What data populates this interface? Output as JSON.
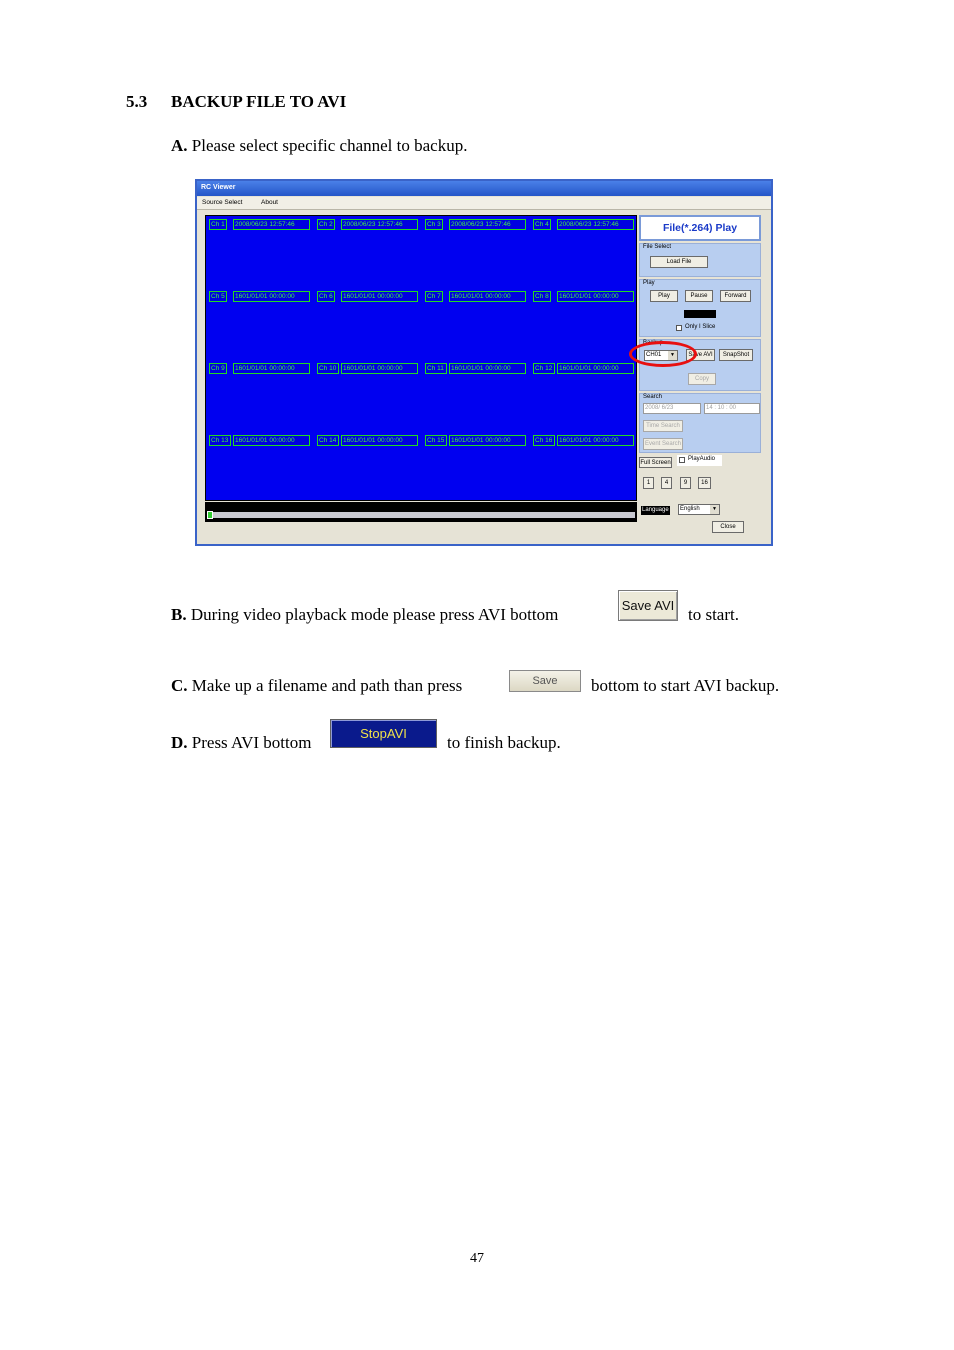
{
  "heading": {
    "number": "5.3",
    "title": "BACKUP FILE TO AVI"
  },
  "steps": {
    "a": {
      "letter": "A.",
      "text": " Please select specific channel to backup."
    },
    "b": {
      "letter": "B.",
      "text": " During video playback mode please press AVI bottom",
      "after": "to start.",
      "button_label": "Save AVI"
    },
    "c": {
      "letter": "C.",
      "text": " Make up a filename and path than press",
      "after": "bottom to start AVI backup.",
      "button_label": "Save"
    },
    "d": {
      "letter": "D.",
      "text": " Press AVI bottom",
      "after": "to finish backup.",
      "button_label": "StopAVI"
    }
  },
  "page_number": "47",
  "screenshot": {
    "window_title": "RC Viewer",
    "menu": [
      "Source Select",
      "About"
    ],
    "channels": [
      {
        "ch": "Ch 1",
        "time": "2008/06/23 12:57:46"
      },
      {
        "ch": "Ch 2",
        "time": "2008/06/23 12:57:46"
      },
      {
        "ch": "Ch 3",
        "time": "2008/06/23 12:57:46"
      },
      {
        "ch": "Ch 4",
        "time": "2008/06/23 12:57:46"
      },
      {
        "ch": "Ch 5",
        "time": "1601/01/01 00:00:00"
      },
      {
        "ch": "Ch 6",
        "time": "1601/01/01 00:00:00"
      },
      {
        "ch": "Ch 7",
        "time": "1601/01/01 00:00:00"
      },
      {
        "ch": "Ch 8",
        "time": "1601/01/01 00:00:00"
      },
      {
        "ch": "Ch 9",
        "time": "1601/01/01 00:00:00"
      },
      {
        "ch": "Ch 10",
        "time": "1601/01/01 00:00:00"
      },
      {
        "ch": "Ch 11",
        "time": "1601/01/01 00:00:00"
      },
      {
        "ch": "Ch 12",
        "time": "1601/01/01 00:00:00"
      },
      {
        "ch": "Ch 13",
        "time": "1601/01/01 00:00:00"
      },
      {
        "ch": "Ch 14",
        "time": "1601/01/01 00:00:00"
      },
      {
        "ch": "Ch 15",
        "time": "1601/01/01 00:00:00"
      },
      {
        "ch": "Ch 16",
        "time": "1601/01/01 00:00:00"
      }
    ],
    "panel": {
      "title": "File(*.264) Play",
      "file_select_label": "File Select",
      "load_file": "Load File",
      "play_label": "Play",
      "play": "Play",
      "pause": "Pause",
      "forward": "Forward",
      "only_i_slice": "Only I Slice",
      "backup_label": "Backup",
      "channel_select": "CH01",
      "save_avi": "Save AVI",
      "snapshot": "SnapShot",
      "copy": "Copy",
      "search_label": "Search",
      "search_date": "2008/ 6/23",
      "search_time": "14 : 10 : 00",
      "time_search": "Time Search",
      "event_search": "Event Search",
      "full_screen": "Full Screen",
      "play_audio": "PlayAudio",
      "layouts": [
        "1",
        "4",
        "9",
        "16"
      ],
      "language_label": "Language",
      "language_value": "English",
      "close": "Close"
    },
    "highlight_color": "#e81010"
  }
}
